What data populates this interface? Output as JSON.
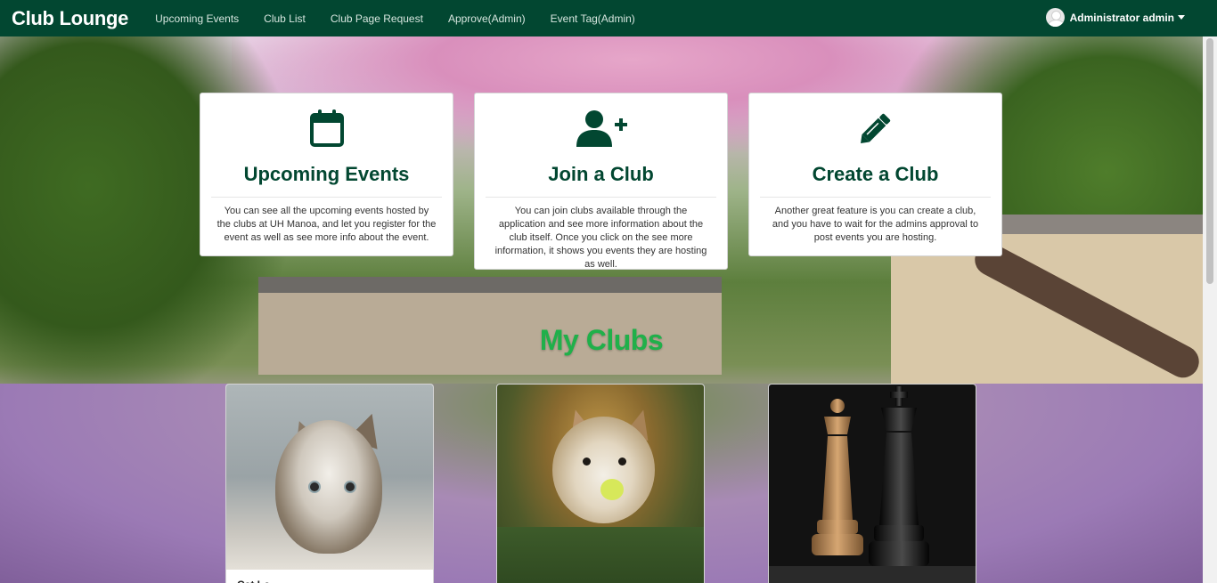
{
  "navbar": {
    "brand": "Club Lounge",
    "links": [
      "Upcoming Events",
      "Club List",
      "Club Page Request",
      "Approve(Admin)",
      "Event Tag(Admin)"
    ],
    "user_label": "Administrator admin"
  },
  "features": [
    {
      "title": "Upcoming Events",
      "icon": "calendar-icon",
      "text": "You can see all the upcoming events hosted by the clubs at UH Manoa, and let you register for the event as well as see more info about the event."
    },
    {
      "title": "Join a Club",
      "icon": "user-plus-icon",
      "text": "You can join clubs available through the application and see more information about the club itself. Once you click on the see more information, it shows you events they are hosting as well."
    },
    {
      "title": "Create a Club",
      "icon": "pencil-icon",
      "text": "Another great feature is you can create a club, and you have to wait for the admins approval to post events you are hosting."
    }
  ],
  "my_clubs": {
    "heading": "My Clubs",
    "clubs": [
      {
        "image": "kitten-photo",
        "name": "Cat Lo..."
      },
      {
        "image": "dog-photo",
        "name": ""
      },
      {
        "image": "chess-photo",
        "name": ""
      }
    ]
  },
  "colors": {
    "navbar_bg": "#024731",
    "accent_dark_green": "#024731",
    "my_clubs_green": "#20b04a"
  }
}
